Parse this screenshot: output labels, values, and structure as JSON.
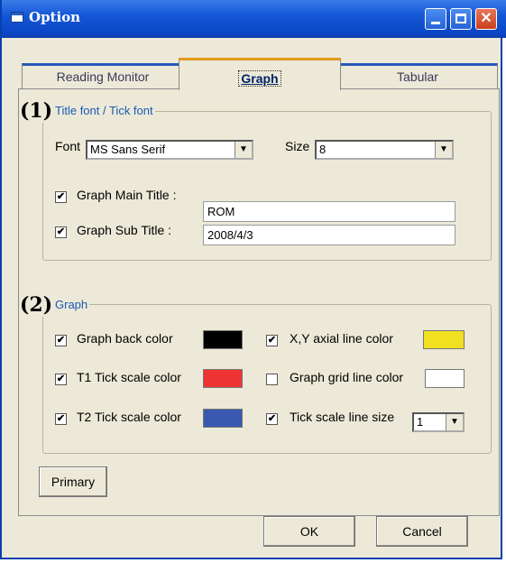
{
  "window": {
    "title": "Option"
  },
  "tabs": [
    {
      "label": "Reading Monitor"
    },
    {
      "label": "Graph"
    },
    {
      "label": "Tabular"
    }
  ],
  "group1": {
    "number": "(1)",
    "label": "Title  font / Tick font",
    "font_label": "Font",
    "font_value": "MS Sans Serif",
    "size_label": "Size",
    "size_value": "8",
    "main_title_label": "Graph  Main Title :",
    "main_title_value": "ROM",
    "sub_title_label": "Graph  Sub Title :",
    "sub_title_value": "2008/4/3"
  },
  "group2": {
    "number": "(2)",
    "label": "Graph",
    "back_color_label": "Graph back color",
    "t1_label": "T1 Tick scale color",
    "t2_label": "T2 Tick scale color",
    "axial_label": "X,Y axial line color",
    "grid_label": "Graph grid line color",
    "line_size_label": "Tick scale line size",
    "line_size_value": "1"
  },
  "colors": {
    "back": "#000000",
    "t1": "#ee3333",
    "t2": "#3a58b0",
    "axial": "#f0e020",
    "grid": "#ffffff"
  },
  "checks": {
    "main_title": "✔",
    "sub_title": "✔",
    "back_color": "✔",
    "t1": "✔",
    "t2": "✔",
    "axial": "✔",
    "grid": "",
    "line_size": "✔"
  },
  "buttons": {
    "primary": "Primary",
    "ok": "OK",
    "cancel": "Cancel"
  }
}
